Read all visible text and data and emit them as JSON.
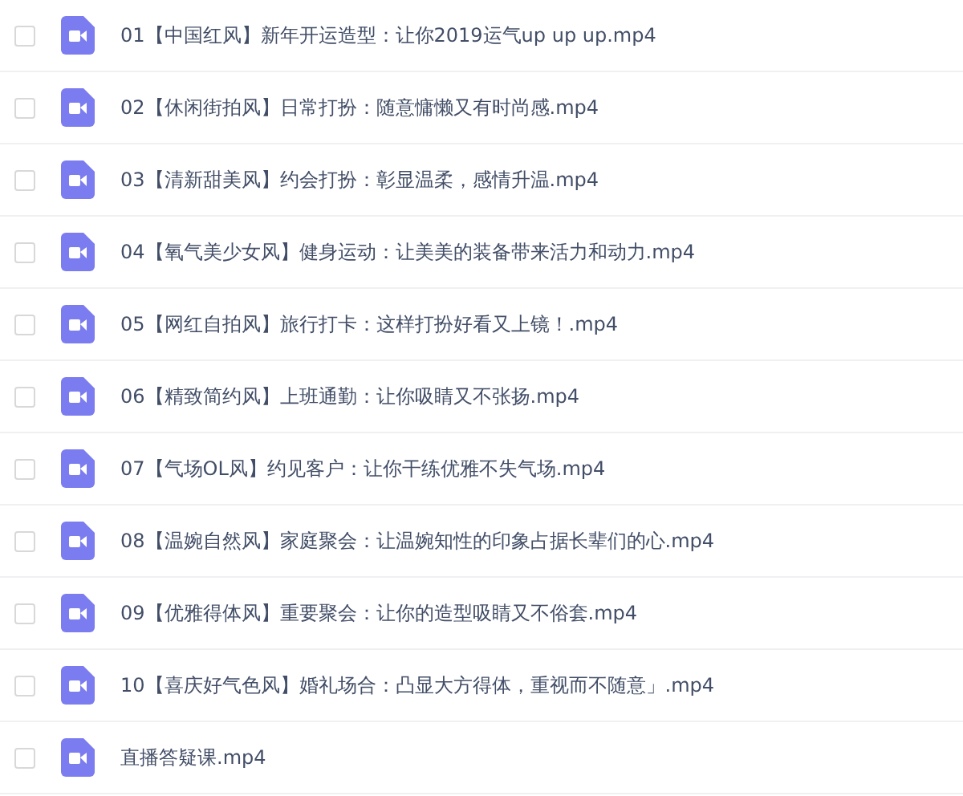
{
  "files": [
    {
      "name": "01【中国红风】新年开运造型：让你2019运气up up up.mp4",
      "checked": false
    },
    {
      "name": "02【休闲街拍风】日常打扮：随意慵懒又有时尚感.mp4",
      "checked": false
    },
    {
      "name": "03【清新甜美风】约会打扮：彰显温柔，感情升温.mp4",
      "checked": false
    },
    {
      "name": "04【氧气美少女风】健身运动：让美美的装备带来活力和动力.mp4",
      "checked": false
    },
    {
      "name": "05【网红自拍风】旅行打卡：这样打扮好看又上镜！.mp4",
      "checked": false
    },
    {
      "name": "06【精致简约风】上班通勤：让你吸睛又不张扬.mp4",
      "checked": false
    },
    {
      "name": "07【气场OL风】约见客户：让你干练优雅不失气场.mp4",
      "checked": false
    },
    {
      "name": "08【温婉自然风】家庭聚会：让温婉知性的印象占据长辈们的心.mp4",
      "checked": false
    },
    {
      "name": "09【优雅得体风】重要聚会：让你的造型吸睛又不俗套.mp4",
      "checked": false
    },
    {
      "name": "10【喜庆好气色风】婚礼场合：凸显大方得体，重视而不随意」.mp4",
      "checked": false
    },
    {
      "name": "直播答疑课.mp4",
      "checked": false
    }
  ]
}
